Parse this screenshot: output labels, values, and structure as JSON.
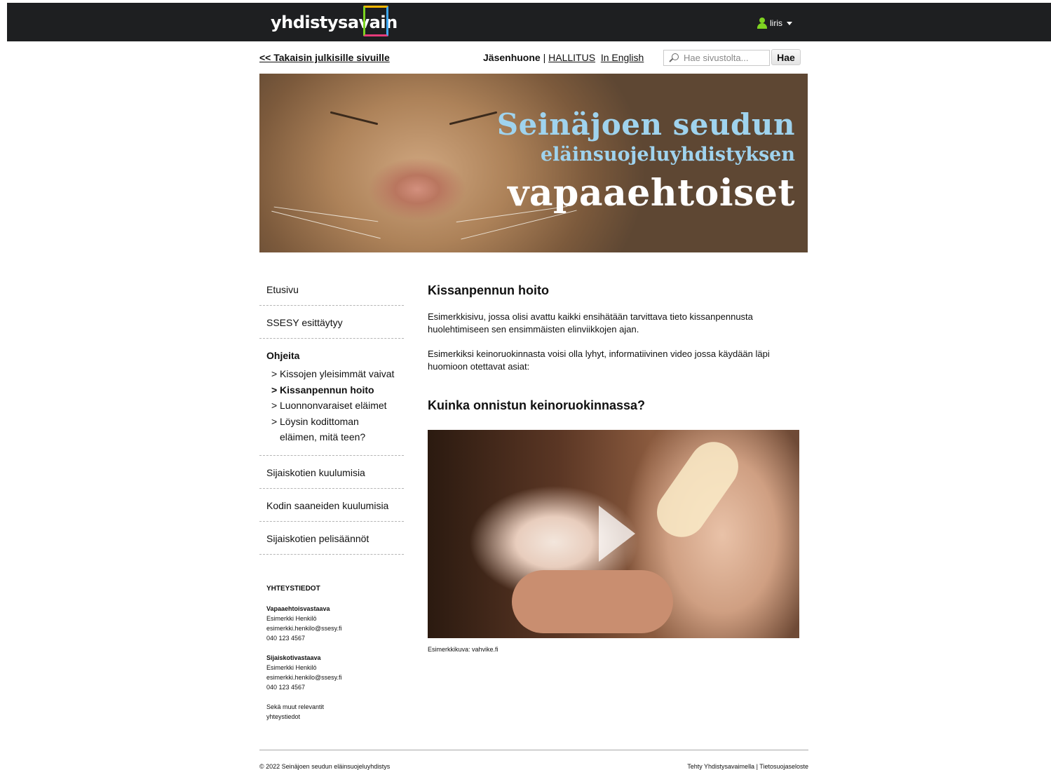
{
  "header": {
    "logo_text": "yhdistysavain",
    "user_name": "liris"
  },
  "topnav": {
    "back_link": "<< Takaisin julkisille sivuille",
    "member_room": "Jäsenhuone",
    "separator": "|",
    "board_link": "HALLITUS",
    "english_link": "In English",
    "search_placeholder": "Hae sivustolta...",
    "search_button": "Hae"
  },
  "hero": {
    "line1": "Seinäjoen seudun",
    "line2": "eläinsuojeluyhdistyksen",
    "line3": "vapaaehtoiset"
  },
  "sidebar": {
    "items": [
      {
        "label": "Etusivu"
      },
      {
        "label": "SSESY esittäytyy"
      }
    ],
    "group": {
      "title": "Ohjeita",
      "subitems": [
        {
          "label": "Kissojen yleisimmät vaivat"
        },
        {
          "label": "Kissanpennun hoito"
        },
        {
          "label": "Luonnonvaraiset eläimet"
        },
        {
          "label": "Löysin kodittoman eläimen, mitä teen?"
        }
      ]
    },
    "items_after": [
      {
        "label": "Sijaiskotien kuulumisia"
      },
      {
        "label": "Kodin saaneiden kuulumisia"
      },
      {
        "label": "Sijaiskotien pelisäännöt"
      }
    ]
  },
  "contacts": {
    "title": "YHTEYSTIEDOT",
    "blocks": [
      {
        "role": "Vapaaehtoisvastaava",
        "name": "Esimerkki Henkilö",
        "email": "esimerkki.henkilo@ssesy.fi",
        "phone": "040 123 4567"
      },
      {
        "role": "Sijaiskotivastaava",
        "name": "Esimerkki Henkilö",
        "email": "esimerkki.henkilo@ssesy.fi",
        "phone": "040 123 4567"
      }
    ],
    "note": "Sekä muut relevantit yhteystiedot"
  },
  "main": {
    "title": "Kissanpennun hoito",
    "paragraphs": [
      "Esimerkkisivu, jossa olisi avattu kaikki ensihätään tarvittava tieto kissanpennusta huolehtimiseen sen ensimmäisten elinviikkojen ajan.",
      "Esimerkiksi keinoruokinnasta voisi olla lyhyt, informatiivinen video jossa käydään läpi huomioon otettavat asiat:"
    ],
    "subheading": "Kuinka onnistun keinoruokinnassa?",
    "video_caption": "Esimerkkikuva: vahvike.fi"
  },
  "footer": {
    "copyright": "© 2022 Seinäjoen seudun eläinsuojeluyhdistys",
    "made_with": "Tehty Yhdistysavaimella",
    "separator": "|",
    "privacy": "Tietosuojaseloste"
  }
}
